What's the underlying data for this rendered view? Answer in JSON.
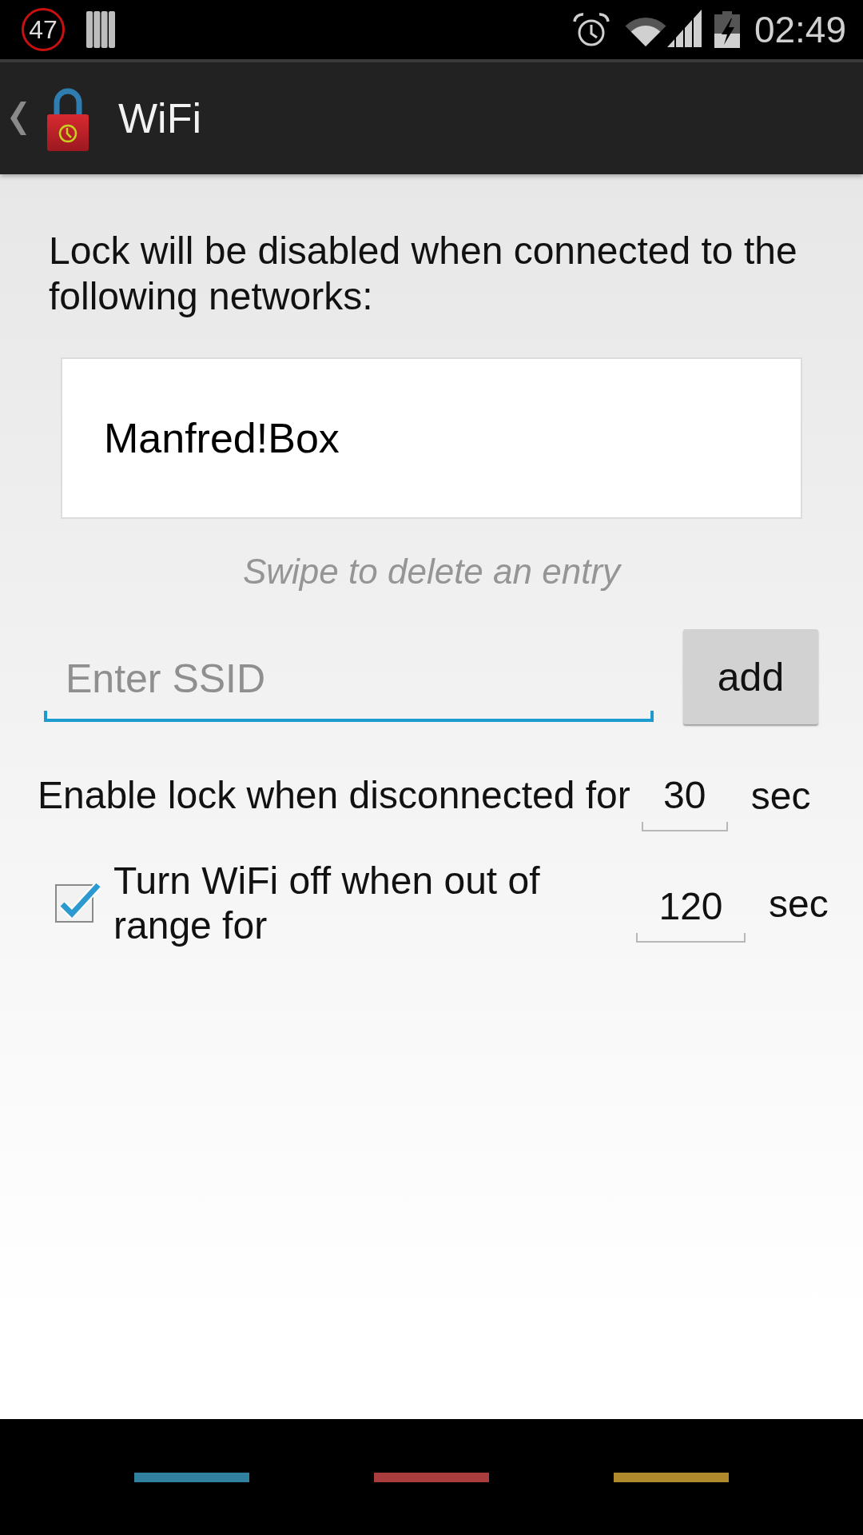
{
  "status_bar": {
    "notification_count": "47",
    "time": "02:49"
  },
  "action_bar": {
    "title": "WiFi"
  },
  "description": "Lock will be disabled when connected to the following networks:",
  "networks": [
    "Manfred!Box"
  ],
  "hint": "Swipe to delete an entry",
  "ssid_field": {
    "placeholder": "Enter SSID"
  },
  "add_button": {
    "label": "add"
  },
  "settings": [
    {
      "kind": "plain",
      "label": "Enable lock when disconnected for",
      "value": "30",
      "unit": "sec"
    },
    {
      "kind": "checkbox",
      "checked": true,
      "label": "Turn WiFi off when out of range for",
      "value": "120",
      "unit": "sec"
    }
  ],
  "nav_bar": [
    {
      "color": "#30809f"
    },
    {
      "color": "#a93d3d"
    },
    {
      "color": "#b08a2d"
    }
  ]
}
